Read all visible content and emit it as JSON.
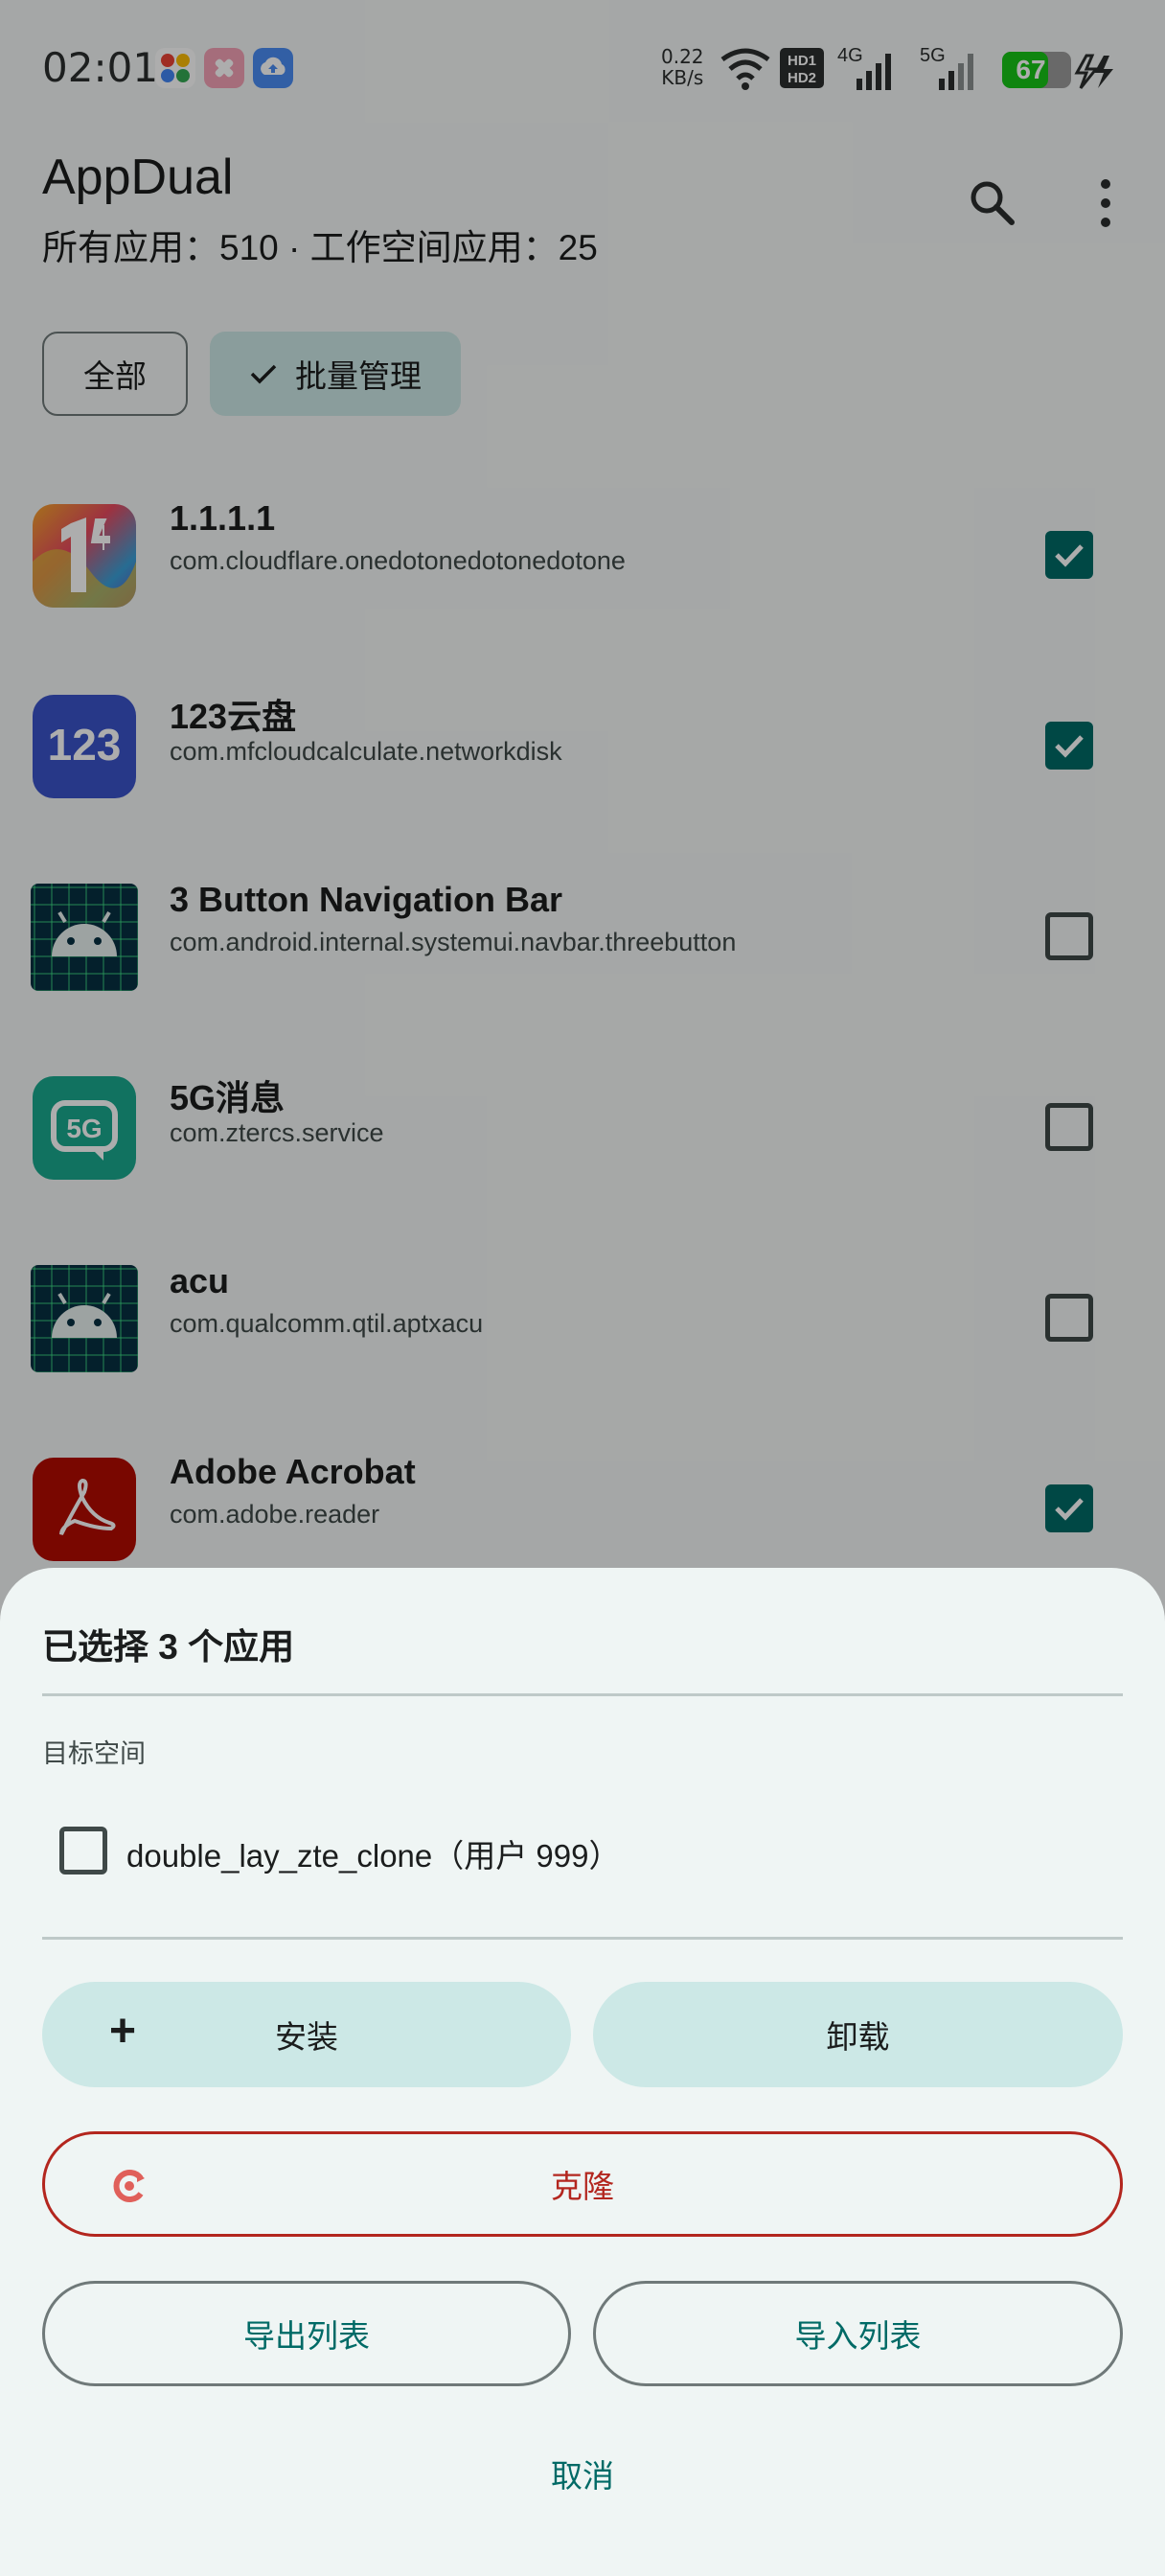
{
  "status_bar": {
    "time": "02:01",
    "net_speed_value": "0.22",
    "net_speed_unit": "KB/s",
    "hd1": "HD1",
    "hd2": "HD2",
    "net_4g": "4G",
    "net_5g": "5G",
    "battery_level": "67",
    "battery_fraction": 0.67,
    "battery_color": "#17c417"
  },
  "header": {
    "title": "AppDual",
    "subtitle": "所有应用：510 · 工作空间应用：25"
  },
  "filters": {
    "all_label": "全部",
    "batch_label": "批量管理"
  },
  "apps": [
    {
      "name": "1.1.1.1",
      "package": "com.cloudflare.onedotonedotonedotone",
      "checked": true,
      "icon": "cloudflare-1111-icon"
    },
    {
      "name": "123云盘",
      "package": "com.mfcloudcalculate.networkdisk",
      "checked": true,
      "icon": "123-cloud-icon",
      "icon_text": "123"
    },
    {
      "name": "3 Button Navigation Bar",
      "package": "com.android.internal.systemui.navbar.threebutton",
      "checked": false,
      "icon": "android-icon"
    },
    {
      "name": "5G消息",
      "package": "com.ztercs.service",
      "checked": false,
      "icon": "5g-message-icon",
      "icon_text": "5G"
    },
    {
      "name": "acu",
      "package": "com.qualcomm.qtil.aptxacu",
      "checked": false,
      "icon": "android-icon"
    },
    {
      "name": "Adobe Acrobat",
      "package": "com.adobe.reader",
      "checked": true,
      "icon": "adobe-acrobat-icon"
    }
  ],
  "sheet": {
    "title": "已选择 3 个应用",
    "target_label": "目标空间",
    "space_option": "double_lay_zte_clone（用户 999）",
    "install_label": "安装",
    "uninstall_label": "卸载",
    "clone_label": "克隆",
    "export_label": "导出列表",
    "import_label": "导入列表",
    "cancel_label": "取消"
  },
  "colors": {
    "accent": "#006a66",
    "tonal": "#cce8e6",
    "danger": "#b3261e"
  }
}
